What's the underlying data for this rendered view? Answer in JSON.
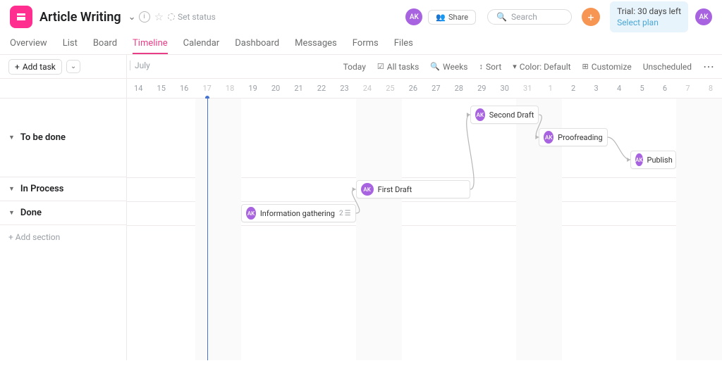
{
  "header": {
    "title": "Article Writing",
    "set_status": "Set status",
    "avatar": "AK",
    "share": "Share",
    "search_placeholder": "Search",
    "trial_line": "Trial: 30 days left",
    "trial_plan": "Select plan"
  },
  "tabs": [
    "Overview",
    "List",
    "Board",
    "Timeline",
    "Calendar",
    "Dashboard",
    "Messages",
    "Forms",
    "Files"
  ],
  "active_tab": 3,
  "toolbar": {
    "add_task": "Add task",
    "month": "July",
    "today": "Today",
    "all_tasks": "All tasks",
    "weeks": "Weeks",
    "sort": "Sort",
    "color": "Color: Default",
    "customize": "Customize",
    "unscheduled": "Unscheduled"
  },
  "dates": [
    "14",
    "15",
    "16",
    "17",
    "18",
    "19",
    "20",
    "21",
    "22",
    "23",
    "24",
    "25",
    "26",
    "27",
    "28",
    "29",
    "30",
    "31",
    "1",
    "2",
    "3",
    "4",
    "5",
    "6",
    "7",
    "8"
  ],
  "today_index": 3,
  "weekend_pairs": [
    [
      3,
      4
    ],
    [
      10,
      11
    ],
    [
      17,
      18
    ],
    [
      24,
      25
    ]
  ],
  "sections": {
    "s1": "To be done",
    "s2": "In Process",
    "s3": "Done",
    "add": "+ Add section"
  },
  "tasks": {
    "t1": {
      "label": "Second Draft",
      "avatar": "AK"
    },
    "t2": {
      "label": "Proofreading",
      "avatar": "AK"
    },
    "t3": {
      "label": "Publish",
      "avatar": "AK"
    },
    "t4": {
      "label": "First Draft",
      "avatar": "AK"
    },
    "t5": {
      "label": "Information gathering",
      "avatar": "AK",
      "sub": "2"
    }
  },
  "chart_data": {
    "type": "gantt",
    "x_unit": "day",
    "x_range": [
      "Jul 14",
      "Aug 8"
    ],
    "sections": [
      "To be done",
      "In Process",
      "Done"
    ],
    "tasks": [
      {
        "name": "Second Draft",
        "section": "To be done",
        "start": "Jul 29",
        "end": "Jul 31",
        "assignee": "AK"
      },
      {
        "name": "Proofreading",
        "section": "To be done",
        "start": "Aug 1",
        "end": "Aug 3",
        "assignee": "AK"
      },
      {
        "name": "Publish",
        "section": "To be done",
        "start": "Aug 5",
        "end": "Aug 7",
        "assignee": "AK"
      },
      {
        "name": "First Draft",
        "section": "In Process",
        "start": "Jul 24",
        "end": "Jul 28",
        "assignee": "AK"
      },
      {
        "name": "Information gathering",
        "section": "Done",
        "start": "Jul 19",
        "end": "Jul 23",
        "assignee": "AK",
        "subtasks": 2
      }
    ],
    "dependencies": [
      [
        "Information gathering",
        "First Draft"
      ],
      [
        "First Draft",
        "Second Draft"
      ],
      [
        "Second Draft",
        "Proofreading"
      ],
      [
        "Proofreading",
        "Publish"
      ]
    ]
  }
}
